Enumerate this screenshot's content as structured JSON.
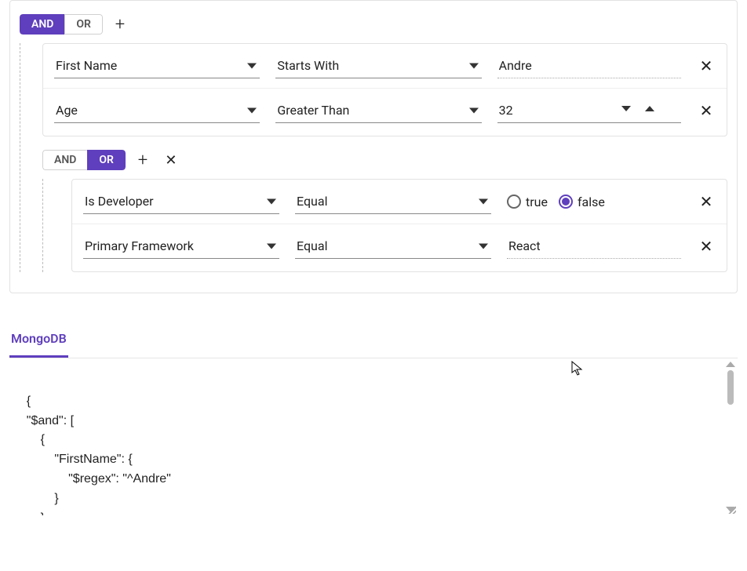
{
  "group1": {
    "and": "AND",
    "or": "OR",
    "active": "and",
    "rules": [
      {
        "field": "First Name",
        "op": "Starts With",
        "value": "Andre",
        "type": "text"
      },
      {
        "field": "Age",
        "op": "Greater Than",
        "value": "32",
        "type": "number"
      }
    ],
    "subgroup": {
      "and": "AND",
      "or": "OR",
      "active": "or",
      "rules": [
        {
          "field": "Is Developer",
          "op": "Equal",
          "type": "bool",
          "true_label": "true",
          "false_label": "false",
          "selected": "false"
        },
        {
          "field": "Primary Framework",
          "op": "Equal",
          "value": "React",
          "type": "select"
        }
      ]
    }
  },
  "output_tab": "MongoDB",
  "output_code": "{\n    \"$and\": [\n        {\n            \"FirstName\": {\n                \"$regex\": \"^Andre\"\n            }\n        },\n        {"
}
